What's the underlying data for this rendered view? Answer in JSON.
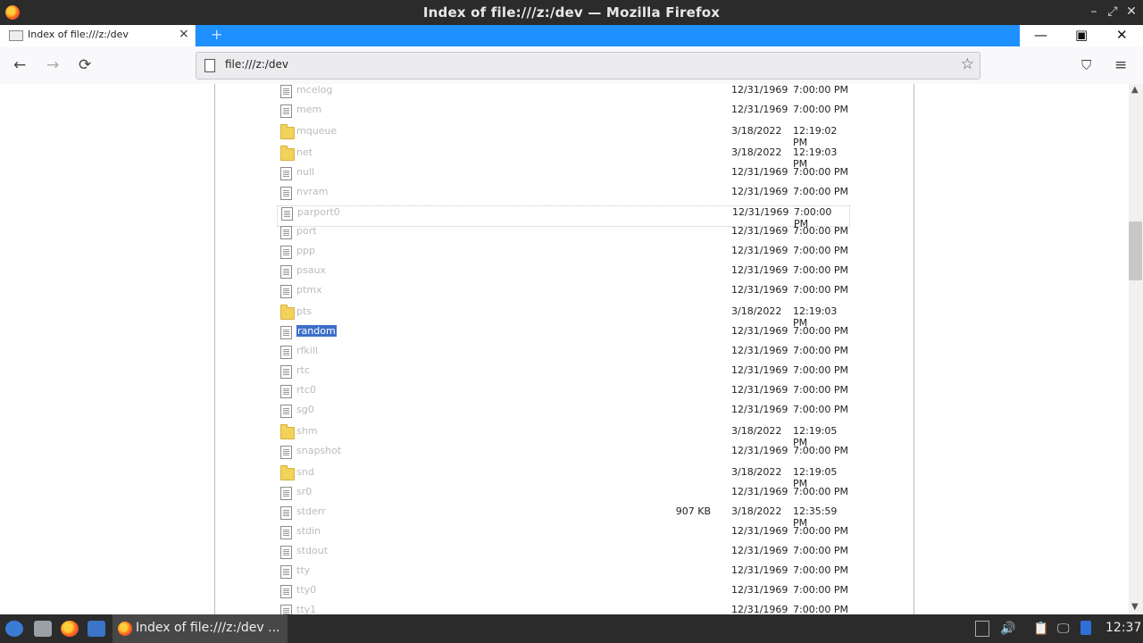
{
  "window": {
    "title": "Index of file:///z:/dev — Mozilla Firefox"
  },
  "tab": {
    "label": "Index of file:///z:/dev",
    "close": "×",
    "new_tab": "+"
  },
  "nav": {
    "back": "←",
    "forward": "→",
    "reload": "⟳",
    "url": "file:///z:/dev",
    "bookmark": "☆",
    "pocket": "⛉",
    "menu": "≡"
  },
  "files": [
    {
      "name": "mcelog",
      "type": "file",
      "size": "",
      "date": "12/31/1969",
      "time": "7:00:00 PM"
    },
    {
      "name": "mem",
      "type": "file",
      "size": "",
      "date": "12/31/1969",
      "time": "7:00:00 PM"
    },
    {
      "name": "mqueue",
      "type": "folder",
      "size": "",
      "date": "3/18/2022",
      "time": "12:19:02 PM"
    },
    {
      "name": "net",
      "type": "folder",
      "size": "",
      "date": "3/18/2022",
      "time": "12:19:03 PM"
    },
    {
      "name": "null",
      "type": "file",
      "size": "",
      "date": "12/31/1969",
      "time": "7:00:00 PM"
    },
    {
      "name": "nvram",
      "type": "file",
      "size": "",
      "date": "12/31/1969",
      "time": "7:00:00 PM"
    },
    {
      "name": "parport0",
      "type": "file",
      "size": "",
      "date": "12/31/1969",
      "time": "7:00:00 PM"
    },
    {
      "name": "port",
      "type": "file",
      "size": "",
      "date": "12/31/1969",
      "time": "7:00:00 PM"
    },
    {
      "name": "ppp",
      "type": "file",
      "size": "",
      "date": "12/31/1969",
      "time": "7:00:00 PM"
    },
    {
      "name": "psaux",
      "type": "file",
      "size": "",
      "date": "12/31/1969",
      "time": "7:00:00 PM"
    },
    {
      "name": "ptmx",
      "type": "file",
      "size": "",
      "date": "12/31/1969",
      "time": "7:00:00 PM"
    },
    {
      "name": "pts",
      "type": "folder",
      "size": "",
      "date": "3/18/2022",
      "time": "12:19:03 PM"
    },
    {
      "name": "random",
      "type": "file",
      "size": "",
      "date": "12/31/1969",
      "time": "7:00:00 PM"
    },
    {
      "name": "rfkill",
      "type": "file",
      "size": "",
      "date": "12/31/1969",
      "time": "7:00:00 PM"
    },
    {
      "name": "rtc",
      "type": "file",
      "size": "",
      "date": "12/31/1969",
      "time": "7:00:00 PM"
    },
    {
      "name": "rtc0",
      "type": "file",
      "size": "",
      "date": "12/31/1969",
      "time": "7:00:00 PM"
    },
    {
      "name": "sg0",
      "type": "file",
      "size": "",
      "date": "12/31/1969",
      "time": "7:00:00 PM"
    },
    {
      "name": "shm",
      "type": "folder",
      "size": "",
      "date": "3/18/2022",
      "time": "12:19:05 PM"
    },
    {
      "name": "snapshot",
      "type": "file",
      "size": "",
      "date": "12/31/1969",
      "time": "7:00:00 PM"
    },
    {
      "name": "snd",
      "type": "folder",
      "size": "",
      "date": "3/18/2022",
      "time": "12:19:05 PM"
    },
    {
      "name": "sr0",
      "type": "file",
      "size": "",
      "date": "12/31/1969",
      "time": "7:00:00 PM"
    },
    {
      "name": "stderr",
      "type": "file",
      "size": "907 KB",
      "date": "3/18/2022",
      "time": "12:35:59 PM"
    },
    {
      "name": "stdin",
      "type": "file",
      "size": "",
      "date": "12/31/1969",
      "time": "7:00:00 PM"
    },
    {
      "name": "stdout",
      "type": "file",
      "size": "",
      "date": "12/31/1969",
      "time": "7:00:00 PM"
    },
    {
      "name": "tty",
      "type": "file",
      "size": "",
      "date": "12/31/1969",
      "time": "7:00:00 PM"
    },
    {
      "name": "tty0",
      "type": "file",
      "size": "",
      "date": "12/31/1969",
      "time": "7:00:00 PM"
    },
    {
      "name": "tty1",
      "type": "file",
      "size": "",
      "date": "12/31/1969",
      "time": "7:00:00 PM"
    }
  ],
  "selected_file": "random",
  "focused_file": "parport0",
  "taskbar": {
    "task_label": "Index of file:///z:/dev ...",
    "clock": "12:37"
  },
  "colors": {
    "tab_strip": "#1e90ff",
    "selection": "#3d6fc9",
    "folder": "#f2d25a"
  }
}
